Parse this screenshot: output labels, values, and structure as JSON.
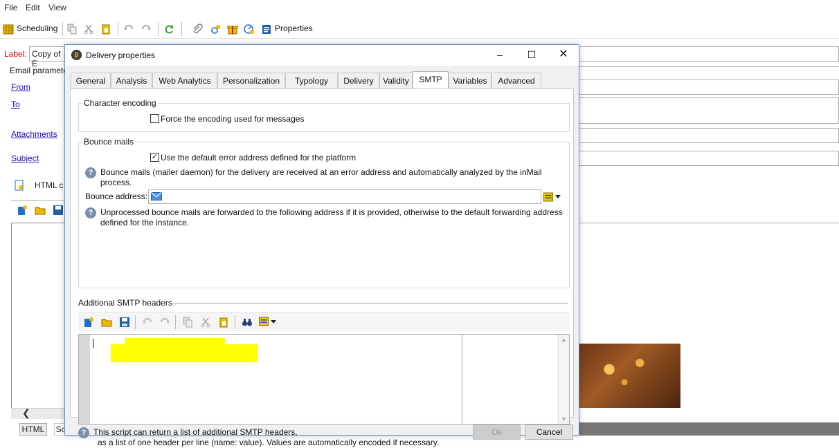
{
  "menu": {
    "file": "File",
    "edit": "Edit",
    "view": "View"
  },
  "toolbar": {
    "scheduling": "Scheduling",
    "properties": "Properties"
  },
  "main": {
    "label_caption": "Label:",
    "label_value": "Copy of E",
    "email_params": "Email paramete",
    "from": "From",
    "to": "To",
    "attachments": "Attachments",
    "subject": "Subject",
    "html_content": "HTML c",
    "html_tab": "HTML",
    "so_tab": "So"
  },
  "dialog": {
    "title": "Delivery properties",
    "tabs": [
      "General",
      "Analysis",
      "Web Analytics",
      "Personalization",
      "Typology",
      "Delivery",
      "Validity",
      "SMTP",
      "Variables",
      "Advanced"
    ],
    "active_tab": "SMTP",
    "char_encoding": {
      "title": "Character encoding",
      "force_label": "Force the encoding used for messages",
      "force_checked": false
    },
    "bounce": {
      "title": "Bounce mails",
      "use_default_label": "Use the default error address defined for the platform",
      "use_default_checked": true,
      "help1": "Bounce mails (mailer daemon) for the delivery are received at an error address and automatically analyzed by the inMail process.",
      "address_label": "Bounce address:",
      "address_value": "",
      "help2": "Unprocessed bounce mails are forwarded to the following address if it is provided, otherwise to the default forwarding address defined for the instance."
    },
    "smtp_headers": {
      "title": "Additional SMTP headers",
      "help_line1": "This script can return a list of additional SMTP headers,",
      "help_line2": "as a list of one header per line (name: value). Values are automatically encoded if necessary."
    },
    "buttons": {
      "ok": "Ok",
      "cancel": "Cancel"
    }
  },
  "colors": {
    "accent_border": "#5a8fc7",
    "label_red": "#c00000",
    "link": "#1a0dab",
    "redaction": "#ffff00"
  }
}
